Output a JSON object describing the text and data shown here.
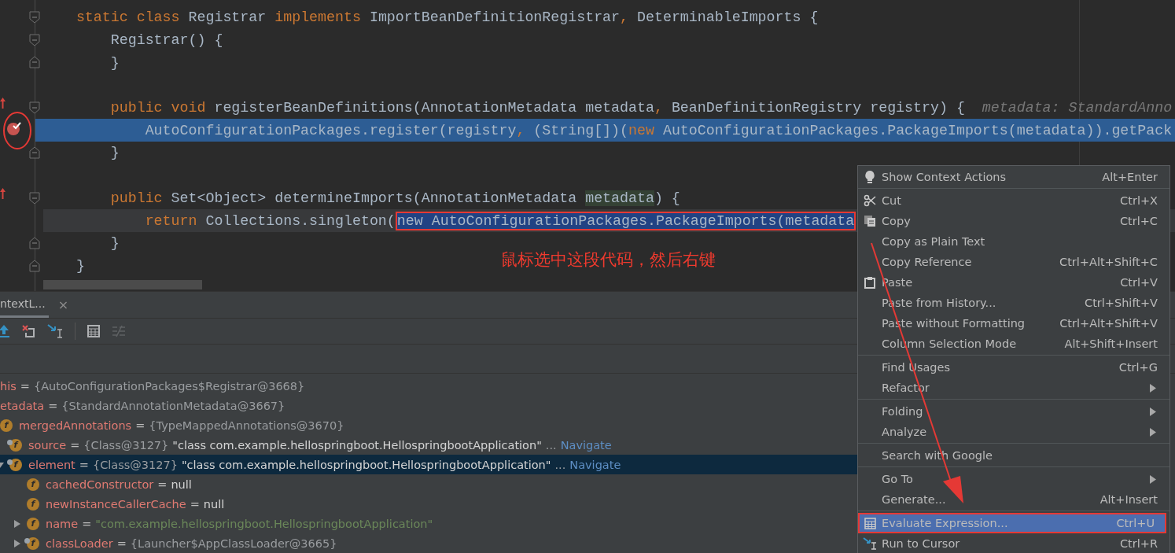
{
  "editor": {
    "blocks": [
      [
        {
          "fold_start": true,
          "tokens": [
            {
              "kind": "keyword",
              "text": "    static class "
            },
            {
              "kind": "plain",
              "text": "Registrar "
            },
            {
              "kind": "keyword",
              "text": "implements "
            },
            {
              "kind": "plain",
              "text": "ImportBeanDefinitionRegistrar"
            },
            {
              "kind": "keyword",
              "text": ", "
            },
            {
              "kind": "plain",
              "text": "DeterminableImports {"
            }
          ]
        },
        {
          "fold_start": true,
          "tokens": [
            {
              "kind": "plain",
              "text": "        Registrar() {"
            }
          ]
        },
        {
          "fold_end": true,
          "tokens": [
            {
              "kind": "plain",
              "text": "        }"
            }
          ]
        }
      ],
      [
        {
          "fold_start": true,
          "override": true,
          "tokens": [
            {
              "kind": "keyword",
              "text": "        public void "
            },
            {
              "kind": "plain",
              "text": "registerBeanDefinitions(AnnotationMetadata metadata"
            },
            {
              "kind": "keyword",
              "text": ", "
            },
            {
              "kind": "plain",
              "text": "BeanDefinitionRegistry registry) {  "
            },
            {
              "kind": "hint",
              "text": "metadata: StandardAnno"
            }
          ]
        },
        {
          "breakpoint": true,
          "circled": true,
          "execution_point": true,
          "tokens": [
            {
              "kind": "plain",
              "text": "            AutoConfigurationPackages.register(registry"
            },
            {
              "kind": "keyword",
              "text": ", "
            },
            {
              "kind": "plain",
              "text": "(String[])("
            },
            {
              "kind": "keyword",
              "text": "new "
            },
            {
              "kind": "plain",
              "text": "AutoConfigurationPackages.PackageImports(metadata)).getPack"
            }
          ]
        },
        {
          "fold_end": true,
          "tokens": [
            {
              "kind": "plain",
              "text": "        }"
            }
          ]
        }
      ],
      [
        {
          "fold_start": true,
          "override": true,
          "tokens": [
            {
              "kind": "keyword",
              "text": "        public "
            },
            {
              "kind": "plain",
              "text": "Set<Object> determineImports(AnnotationMetadata "
            },
            {
              "kind": "usage",
              "text": "metadata"
            },
            {
              "kind": "plain",
              "text": ") {"
            }
          ]
        },
        {
          "caret_line": true,
          "tokens": [
            {
              "kind": "keyword",
              "text": "            return "
            },
            {
              "kind": "plain",
              "text": "Collections.singleton("
            },
            {
              "kind": "selection",
              "boxed": true,
              "text": "new AutoConfigurationPackages.PackageImports(metadata"
            }
          ]
        },
        {
          "fold_end": true,
          "tokens": [
            {
              "kind": "plain",
              "text": "        }"
            }
          ]
        },
        {
          "fold_end": true,
          "tokens": [
            {
              "kind": "plain",
              "text": "    }"
            }
          ]
        }
      ]
    ]
  },
  "annotation": {
    "note": "鼠标选中这段代码，然后右键",
    "arrow": true
  },
  "debug_panel": {
    "tab": {
      "label": "ntextL...",
      "close": "×"
    },
    "variables": [
      {
        "name": "his",
        "selected": false,
        "value": [
          {
            "kind": "op",
            "text": "="
          },
          {
            "kind": "ref",
            "text": "{AutoConfigurationPackages$Registrar@3668}"
          }
        ]
      },
      {
        "name": "etadata",
        "selected": false,
        "value": [
          {
            "kind": "op",
            "text": "="
          },
          {
            "kind": "ref",
            "text": "{StandardAnnotationMetadata@3667}"
          }
        ],
        "children": [
          {
            "name": "mergedAnnotations",
            "icon": "f",
            "marked": false,
            "selected": false,
            "value": [
              {
                "kind": "op",
                "text": "="
              },
              {
                "kind": "ref",
                "text": "{TypeMappedAnnotations@3670}"
              }
            ],
            "children": [
              {
                "name": "source",
                "icon": "f",
                "marked": true,
                "selected": false,
                "value": [
                  {
                    "kind": "op",
                    "text": "="
                  },
                  {
                    "kind": "ref",
                    "text": "{Class@3127}"
                  },
                  {
                    "kind": "str",
                    "text": "\"class com.example.hellospringboot.HellospringbootApplication\""
                  },
                  {
                    "kind": "ref",
                    "text": "..."
                  },
                  {
                    "kind": "link",
                    "text": "Navigate"
                  }
                ]
              },
              {
                "name": "element",
                "icon": "f",
                "marked": true,
                "expanded": true,
                "selected": true,
                "value": [
                  {
                    "kind": "op",
                    "text": "="
                  },
                  {
                    "kind": "ref",
                    "text": "{Class@3127}"
                  },
                  {
                    "kind": "str",
                    "text": "\"class com.example.hellospringboot.HellospringbootApplication\""
                  },
                  {
                    "kind": "ref",
                    "text": "..."
                  },
                  {
                    "kind": "link",
                    "text": "Navigate"
                  }
                ],
                "children": [
                  {
                    "name": "cachedConstructor",
                    "icon": "f",
                    "marked": false,
                    "selected": false,
                    "value": [
                      {
                        "kind": "op",
                        "text": "="
                      },
                      {
                        "kind": "str",
                        "text": "null"
                      }
                    ]
                  },
                  {
                    "name": "newInstanceCallerCache",
                    "icon": "f",
                    "marked": false,
                    "selected": false,
                    "value": [
                      {
                        "kind": "op",
                        "text": "="
                      },
                      {
                        "kind": "str",
                        "text": "null"
                      }
                    ]
                  },
                  {
                    "name": "name",
                    "icon": "f",
                    "marked": false,
                    "expanded": false,
                    "selected": false,
                    "value": [
                      {
                        "kind": "op",
                        "text": "="
                      },
                      {
                        "kind": "string",
                        "text": "\"com.example.hellospringboot.HellospringbootApplication\""
                      }
                    ]
                  },
                  {
                    "name": "classLoader",
                    "icon": "f",
                    "marked": true,
                    "expanded": false,
                    "selected": false,
                    "value": [
                      {
                        "kind": "op",
                        "text": "="
                      },
                      {
                        "kind": "ref",
                        "text": "{Launcher$AppClassLoader@3665}"
                      }
                    ]
                  }
                ]
              }
            ]
          }
        ]
      }
    ]
  },
  "context_menu": {
    "groups": [
      [
        {
          "label": "Show Context Actions",
          "kind": "bulb",
          "shortcut": "Alt+Enter",
          "selected": false
        }
      ],
      [
        {
          "label": "Cut",
          "kind": "scissors",
          "shortcut": "Ctrl+X",
          "selected": false
        },
        {
          "label": "Copy",
          "kind": "copy",
          "shortcut": "Ctrl+C",
          "selected": false
        },
        {
          "label": "Copy as Plain Text",
          "selected": false
        },
        {
          "label": "Copy Reference",
          "shortcut": "Ctrl+Alt+Shift+C",
          "selected": false
        },
        {
          "label": "Paste",
          "kind": "paste",
          "shortcut": "Ctrl+V",
          "selected": false
        },
        {
          "label": "Paste from History...",
          "shortcut": "Ctrl+Shift+V",
          "selected": false
        },
        {
          "label": "Paste without Formatting",
          "shortcut": "Ctrl+Alt+Shift+V",
          "selected": false
        },
        {
          "label": "Column Selection Mode",
          "shortcut": "Alt+Shift+Insert",
          "selected": false
        }
      ],
      [
        {
          "label": "Find Usages",
          "shortcut": "Ctrl+G",
          "selected": false
        },
        {
          "label": "Refactor",
          "submenu": true,
          "selected": false
        }
      ],
      [
        {
          "label": "Folding",
          "submenu": true,
          "selected": false
        },
        {
          "label": "Analyze",
          "submenu": true,
          "selected": false
        }
      ],
      [
        {
          "label": "Search with Google",
          "selected": false
        }
      ],
      [
        {
          "label": "Go To",
          "submenu": true,
          "selected": false
        },
        {
          "label": "Generate...",
          "shortcut": "Alt+Insert",
          "selected": false
        }
      ],
      [
        {
          "label": "Evaluate Expression...",
          "kind": "evaluate",
          "shortcut": "Ctrl+U",
          "selected": true,
          "boxed": true
        },
        {
          "label": "Run to Cursor",
          "kind": "run-cursor",
          "shortcut": "Ctrl+R",
          "selected": false
        }
      ]
    ]
  }
}
